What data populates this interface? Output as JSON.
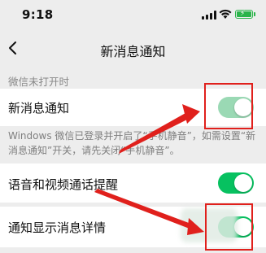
{
  "status_bar": {
    "time": "9:18",
    "icons": [
      "signal-icon",
      "wifi-icon",
      "battery-charging-icon"
    ],
    "battery_color": "#2bb44a"
  },
  "nav": {
    "back_icon": "chevron-left-icon",
    "title": "新消息通知"
  },
  "section": {
    "label": "微信未打开时"
  },
  "settings": [
    {
      "label": "新消息通知",
      "enabled": true
    },
    {
      "label": "语音和视频通话提醒",
      "enabled": true
    },
    {
      "label": "通知显示消息详情",
      "enabled": true
    }
  ],
  "description": "Windows 微信已登录并开启了“手机静音”，如需设置“新消息通知”开关，请先关闭“手机静音”。",
  "colors": {
    "toggle_on": "#07c160",
    "annotation": "#e0201c",
    "background": "#ededed"
  }
}
